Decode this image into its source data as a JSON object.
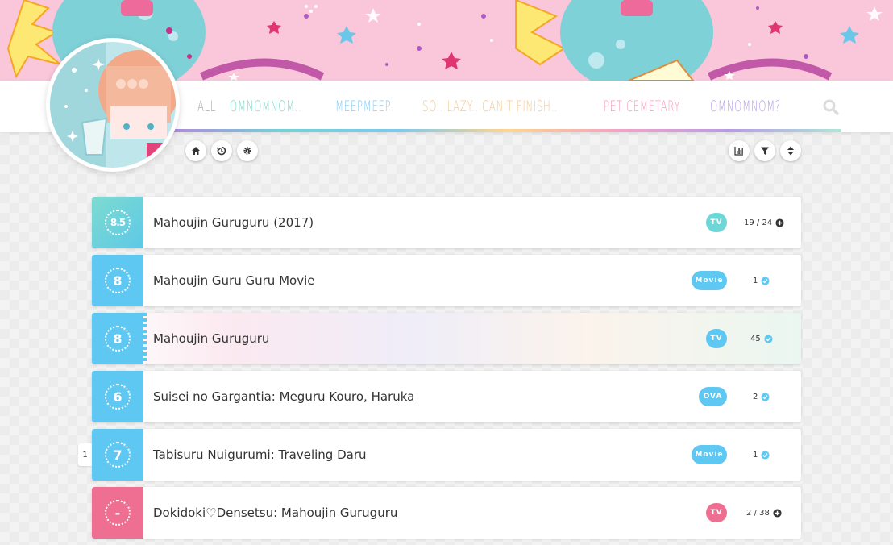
{
  "colors": {
    "teal": "#6fd6d8",
    "blue": "#5ec8f2",
    "pink": "#ef6f93",
    "page_bg": "#ececec"
  },
  "nav": {
    "items": [
      {
        "label": "All",
        "color": "#a7a7a7"
      },
      {
        "label": "omnomnom..",
        "color": "#7fd8c6"
      },
      {
        "label": "meepmeep!",
        "color": "#87c9f2"
      },
      {
        "label": "so.. lazy.. can't finish..",
        "color": "#f5c88d"
      },
      {
        "label": "pet cemetary",
        "color": "#f39aba"
      },
      {
        "label": "omnomnom?",
        "color": "#b49ee6"
      }
    ],
    "search_icon": "search-icon"
  },
  "toolbar": {
    "left": [
      "home-icon",
      "history-icon",
      "gear-icon"
    ],
    "right": [
      "stats-icon",
      "filter-icon",
      "sort-icon"
    ]
  },
  "entries": [
    {
      "score": "8.5",
      "title": "Mahoujin Guruguru (2017)",
      "type": "TV",
      "progress": "19 / 24",
      "status": "watching",
      "status_icon": "plus-circle-icon",
      "color": "#6fd6d8"
    },
    {
      "score": "8",
      "title": "Mahoujin Guru Guru Movie",
      "type": "Movie",
      "progress": "1",
      "status": "completed",
      "status_icon": "check-circle-icon",
      "color": "#5ec8f2"
    },
    {
      "score": "8",
      "title": "Mahoujin Guruguru",
      "type": "TV",
      "progress": "45",
      "status": "completed",
      "status_icon": "check-circle-icon",
      "color": "#5ec8f2"
    },
    {
      "score": "6",
      "title": "Suisei no Gargantia: Meguru Kouro, Haruka",
      "type": "OVA",
      "progress": "2",
      "status": "completed",
      "status_icon": "check-circle-icon",
      "color": "#5ec8f2"
    },
    {
      "score": "7",
      "title": "Tabisuru Nuigurumi: Traveling Daru",
      "type": "Movie",
      "progress": "1",
      "status": "completed",
      "status_icon": "check-circle-icon",
      "color": "#5ec8f2"
    },
    {
      "score": "-",
      "title": "Dokidoki♡Densetsu: Mahoujin Guruguru",
      "type": "TV",
      "progress": "2 / 38",
      "status": "dropped",
      "status_icon": "plus-circle-icon",
      "color": "#ef6f93"
    }
  ],
  "side_tab_label": "1"
}
